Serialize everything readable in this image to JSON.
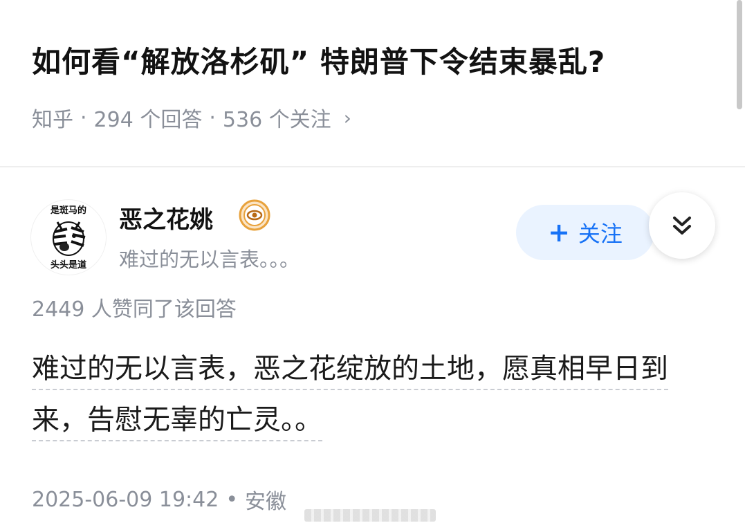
{
  "question": {
    "title": "如何看“解放洛杉矶” 特朗普下令结束暴乱?",
    "source": "知乎",
    "answers": "294 个回答",
    "followers": "536 个关注",
    "separator": "·",
    "chevron": "›"
  },
  "author": {
    "name": "恶之花姚",
    "bio": "难过的无以言表。。。",
    "avatar_top_text": "是斑马的",
    "avatar_bottom_text": "头头是道",
    "badge_icon": "eye-badge-icon",
    "follow_label": "关注",
    "follow_plus": "+",
    "collapse_icon": "double-chevron-down-icon"
  },
  "answer": {
    "votes": "2449 人赞同了该回答",
    "content": "难过的无以言表，恶之花绽放的土地，愿真相早日到来，告慰无辜的亡灵。。",
    "date": "2025-06-09 19:42",
    "location": "安徽",
    "separator": "•"
  },
  "colors": {
    "accent": "#1772f6",
    "follow_bg": "#eaf3ff",
    "muted_text": "#8a8f99",
    "badge": "#e8a23c"
  }
}
